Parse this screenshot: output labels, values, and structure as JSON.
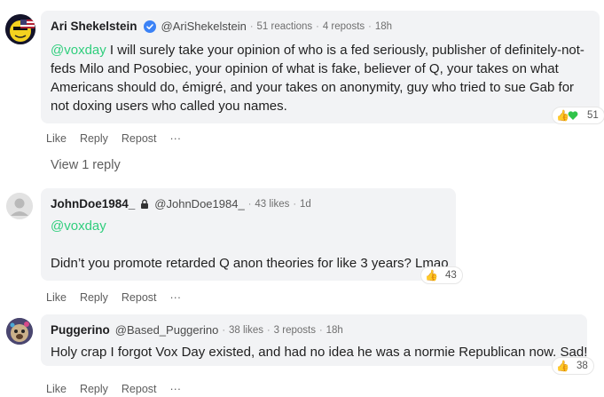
{
  "comments": [
    {
      "name": "Ari Shekelstein",
      "handle": "@AriShekelstein",
      "stats": "51 reactions",
      "reposts": "4 reposts",
      "time": "18h",
      "verified": true,
      "mention": "@voxday",
      "text": " I will surely take your opinion of who is a fed seriously, publisher of definitely-not-feds Milo and Posobiec, your opinion of what is fake, believer of Q, your takes on what Americans should do, émigré, and your takes on anonymity, guy who tried to sue Gab for not doxing users who called you names.",
      "reaction_count": "51",
      "reaction_icons": [
        "thumbs-up",
        "green-heart"
      ],
      "actions": [
        "Like",
        "Reply",
        "Repost",
        "···"
      ],
      "view_replies": "View 1 reply"
    },
    {
      "name": "JohnDoe1984_",
      "handle": "@JohnDoe1984_",
      "stats": "43 likes",
      "time": "1d",
      "locked": true,
      "mention": "@voxday",
      "text": "Didn’t you promote retarded Q anon theories for like 3 years? Lmao",
      "reaction_count": "43",
      "reaction_icons": [
        "thumbs-up"
      ],
      "actions": [
        "Like",
        "Reply",
        "Repost",
        "···"
      ]
    },
    {
      "name": "Puggerino",
      "handle": "@Based_Puggerino",
      "stats": "38 likes",
      "reposts": "3 reposts",
      "time": "18h",
      "text": "Holy crap I forgot Vox Day existed, and had no idea he was a normie Republican now. Sad!",
      "reaction_count": "38",
      "reaction_icons": [
        "thumbs-up"
      ],
      "actions": [
        "Like",
        "Reply",
        "Repost",
        "···"
      ]
    }
  ],
  "colors": {
    "mention": "#30ce7d",
    "verified": "#3b82f6",
    "bubble": "#f2f3f5"
  }
}
